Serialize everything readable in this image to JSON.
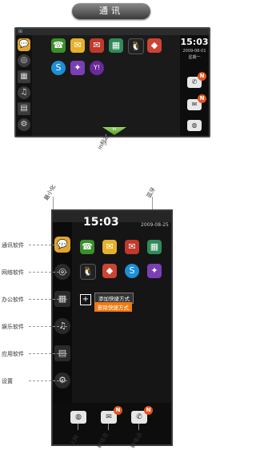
{
  "header": {
    "title": "通讯"
  },
  "screen1": {
    "time": "15:03",
    "date": "2009-08-01",
    "weekday": "星期一",
    "tray_label": "in",
    "apps_row1": [
      "☎",
      "✉",
      "✉",
      "▦",
      "🐧",
      "◆"
    ],
    "apps_row2": [
      "S",
      "✦",
      "Y!"
    ]
  },
  "callouts": {
    "in_label": "in标志",
    "minimize": "最小化",
    "bluetooth": "蓝牙",
    "comm_software": "通讯软件",
    "network_software": "网络软件",
    "office_software": "办公软件",
    "entertainment_software": "娱乐软件",
    "app_software": "应用软件",
    "settings": "设置",
    "internet": "上网",
    "new_message": "新信息",
    "new_call": "新电话"
  },
  "screen2": {
    "time": "15:03",
    "date": "2009-08-25",
    "add_shortcut": "添加快捷方式",
    "delete_shortcut": "删除快捷方式"
  },
  "badge": "N",
  "colors": {
    "accent": "#e0551c",
    "menu_highlight": "#f07a10"
  }
}
